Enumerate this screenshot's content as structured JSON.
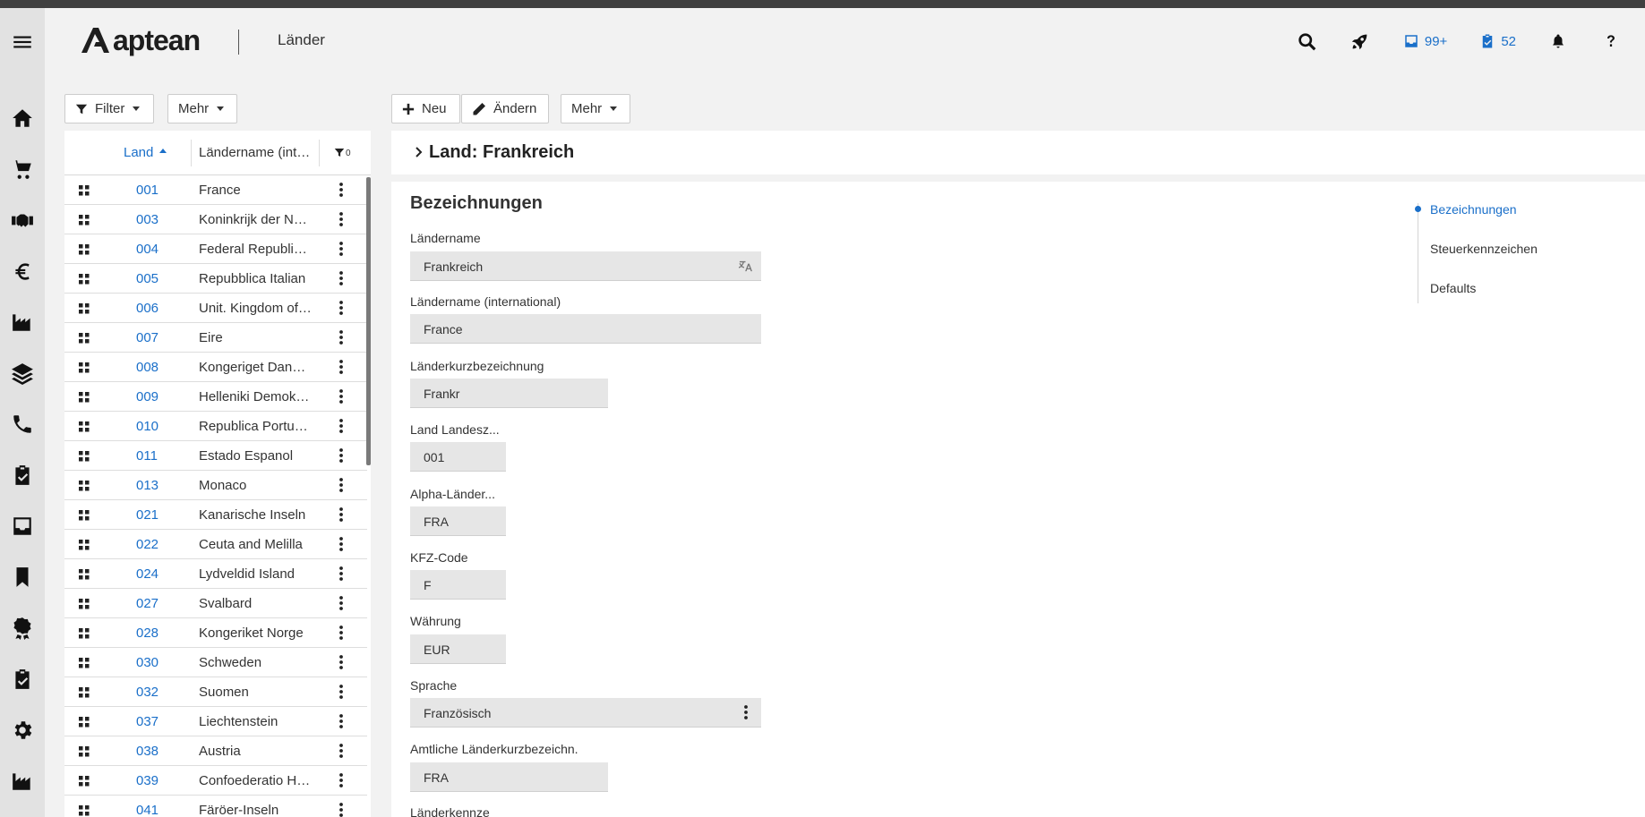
{
  "header": {
    "brand": "aptean",
    "title": "Länder",
    "badge_inbox_count": "99+",
    "badge_tasks_count": "52",
    "accent_color": "#1a6fc9"
  },
  "sidebar": {
    "icons": [
      "home-icon",
      "cart-icon",
      "handshake-icon",
      "euro-icon",
      "factory-icon",
      "layers-icon",
      "phone-icon",
      "clipboard-check-icon",
      "inbox-icon",
      "bookmark-icon",
      "award-icon",
      "clipboard-check-icon",
      "gear-icon",
      "factory-icon"
    ]
  },
  "toolbar_left": {
    "filter_label": "Filter",
    "more_label": "Mehr"
  },
  "toolbar_right": {
    "new_label": "Neu",
    "edit_label": "Ändern",
    "more_label": "Mehr"
  },
  "list": {
    "col_land": "Land",
    "col_name": "Ländername (international)",
    "filter_count": "0",
    "rows": [
      {
        "code": "001",
        "name": "France"
      },
      {
        "code": "003",
        "name": "Koninkrijk der Nederlanden"
      },
      {
        "code": "004",
        "name": "Federal Republic of Germany"
      },
      {
        "code": "005",
        "name": "Repubblica Italian"
      },
      {
        "code": "006",
        "name": "Unit. Kingdom of Great Britain"
      },
      {
        "code": "007",
        "name": "Eire"
      },
      {
        "code": "008",
        "name": "Kongeriget Danmark"
      },
      {
        "code": "009",
        "name": "Helleniki Demokratia"
      },
      {
        "code": "010",
        "name": "Republica Portuguesa"
      },
      {
        "code": "011",
        "name": "Estado Espanol"
      },
      {
        "code": "013",
        "name": "Monaco"
      },
      {
        "code": "021",
        "name": "Kanarische Inseln"
      },
      {
        "code": "022",
        "name": "Ceuta and Melilla"
      },
      {
        "code": "024",
        "name": "Lydveldid Island"
      },
      {
        "code": "027",
        "name": "Svalbard"
      },
      {
        "code": "028",
        "name": "Kongeriket Norge"
      },
      {
        "code": "030",
        "name": "Schweden"
      },
      {
        "code": "032",
        "name": "Suomen"
      },
      {
        "code": "037",
        "name": "Liechtenstein"
      },
      {
        "code": "038",
        "name": "Austria"
      },
      {
        "code": "039",
        "name": "Confoederatio Helvetica"
      },
      {
        "code": "041",
        "name": "Färöer-Inseln"
      }
    ]
  },
  "detail": {
    "title": "Land: Frankreich",
    "section_title": "Bezeichnungen",
    "fields": {
      "laendername": {
        "label": "Ländername",
        "value": "Frankreich"
      },
      "laendername_int": {
        "label": "Ländername (international)",
        "value": "France"
      },
      "kurzbezeichnung": {
        "label": "Länderkurzbezeichnung",
        "value": "Frankr"
      },
      "landesz": {
        "label": "Land Landesz...",
        "value": "001"
      },
      "alpha": {
        "label": "Alpha-Länder...",
        "value": "FRA"
      },
      "kfz": {
        "label": "KFZ-Code",
        "value": "F"
      },
      "waehrung": {
        "label": "Währung",
        "value": "EUR"
      },
      "sprache": {
        "label": "Sprache",
        "value": "Französisch"
      },
      "amtlich": {
        "label": "Amtliche Länderkurzbezeichn.",
        "value": "FRA"
      },
      "kennze": {
        "label": "Länderkennze"
      }
    }
  },
  "anchors": {
    "items": [
      "Bezeichnungen",
      "Steuerkennzeichen",
      "Defaults"
    ]
  }
}
